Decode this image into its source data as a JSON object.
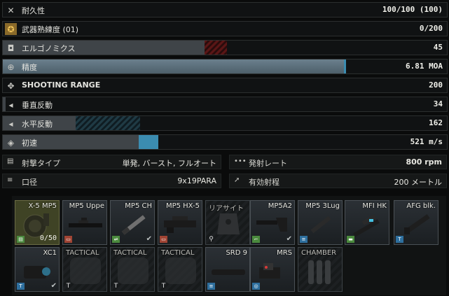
{
  "stats": [
    {
      "label": "耐久性",
      "value": "100/100 (100)",
      "icon": "wrench-icon",
      "glyph": "✕",
      "fill": 0.0
    },
    {
      "label": "武器熟練度 (01)",
      "value": "0/200",
      "icon": "medal-icon",
      "glyph": "✪",
      "fill": 0.0
    },
    {
      "label": "エルゴノミクス",
      "value": "45",
      "icon": "ergonomics-icon",
      "glyph": "◘",
      "fill": 0.45
    },
    {
      "label": "精度",
      "value": "6.81 MOA",
      "icon": "crosshair-icon",
      "glyph": "⊕",
      "fill": 0.77
    },
    {
      "label": "SHOOTING RANGE",
      "value": "200",
      "icon": "target-icon",
      "glyph": "✥",
      "fill": 0.0
    },
    {
      "label": "垂直反動",
      "value": "34",
      "icon": "vertical-recoil-icon",
      "glyph": "◂",
      "fill": 0.0
    },
    {
      "label": "水平反動",
      "value": "162",
      "icon": "horizontal-recoil-icon",
      "glyph": "◂",
      "fill": 0.16
    },
    {
      "label": "初速",
      "value": "521 m/s",
      "icon": "velocity-icon",
      "glyph": "◈",
      "fill": 0.3
    }
  ],
  "info": [
    {
      "label": "射撃タイプ",
      "value": "単発, バースト, フルオート",
      "icon": "fire-type-icon",
      "glyph": "▤"
    },
    {
      "label": "発射レート",
      "value": "800 rpm",
      "icon": "fire-rate-icon",
      "glyph": "•••"
    },
    {
      "label": "口径",
      "value": "9x19PARA",
      "icon": "caliber-icon",
      "glyph": "≡"
    },
    {
      "label": "有効射程",
      "value": "200 メートル",
      "icon": "range-icon",
      "glyph": "➚"
    }
  ],
  "slots": [
    {
      "name": "X-5 MP5",
      "count": "0/50",
      "type": "olive",
      "badge": "▤",
      "badge_color": "green",
      "icon": "drum-magazine-icon"
    },
    {
      "name": "MP5 Uppe",
      "type": "filled",
      "badge": "▭",
      "badge_color": "red",
      "icon": "upper-receiver-icon"
    },
    {
      "name": "MP5 CH",
      "type": "filled",
      "badge": "⇌",
      "badge_color": "green",
      "check": true,
      "icon": "charging-handle-icon"
    },
    {
      "name": "MP5 HX-5",
      "type": "filled",
      "badge": "▭",
      "badge_color": "red",
      "icon": "handguard-icon"
    },
    {
      "name": "リアサイト",
      "type": "empty",
      "badge": "⚲",
      "badge_color": "gray",
      "icon": "rear-sight-icon"
    },
    {
      "name": "MP5A2",
      "type": "filled",
      "badge": "⌐",
      "badge_color": "green",
      "check": true,
      "icon": "stock-icon"
    },
    {
      "name": "MP5 3Lug",
      "type": "filled",
      "badge": "≡",
      "badge_color": "blue",
      "icon": "barrel-adapter-icon"
    },
    {
      "name": "MFI HK",
      "type": "filled",
      "badge": "▬",
      "badge_color": "green",
      "icon": "scope-mount-icon"
    },
    {
      "name": "AFG blk.",
      "type": "filled",
      "badge": "T",
      "badge_color": "blue",
      "icon": "foregrip-icon"
    },
    {
      "name": "XC1",
      "type": "filled",
      "badge": "T",
      "badge_color": "blue",
      "check": true,
      "icon": "flashlight-icon"
    },
    {
      "name": "TACTICAL",
      "type": "empty",
      "badge": "T ═",
      "badge_color": "gray",
      "icon": "tactical-slot-icon"
    },
    {
      "name": "TACTICAL",
      "type": "empty",
      "badge": "T ═",
      "badge_color": "gray",
      "icon": "tactical-slot-icon"
    },
    {
      "name": "TACTICAL",
      "type": "empty",
      "badge": "T ═",
      "badge_color": "gray",
      "icon": "tactical-slot-icon"
    },
    {
      "name": "SRD 9",
      "type": "filled",
      "badge": "≡",
      "badge_color": "blue",
      "icon": "suppressor-icon"
    },
    {
      "name": "MRS",
      "type": "filled",
      "badge": "◎",
      "badge_color": "blue",
      "icon": "reflex-sight-icon"
    },
    {
      "name": "CHAMBER",
      "type": "empty",
      "badge": "",
      "badge_color": "gray",
      "icon": "chamber-icon"
    }
  ]
}
